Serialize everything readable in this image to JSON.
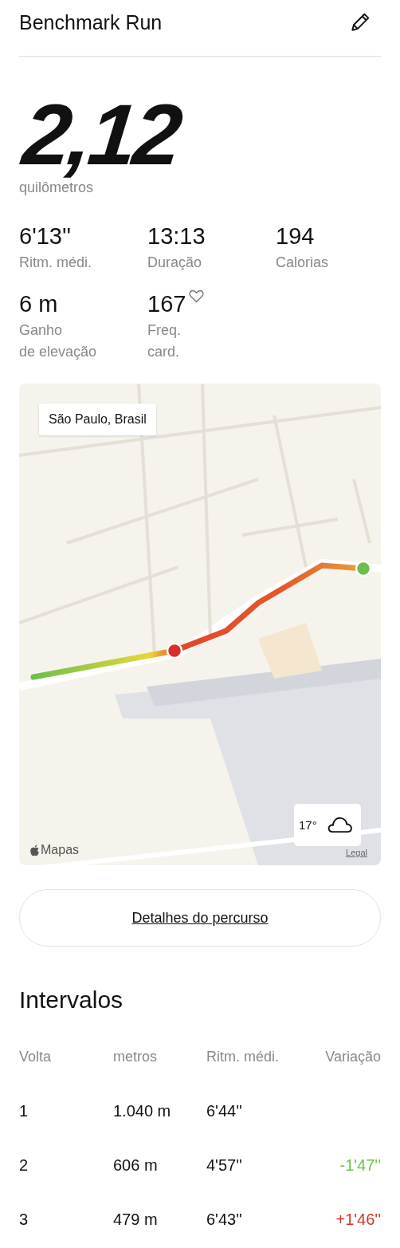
{
  "header": {
    "title": "Benchmark Run"
  },
  "distance": {
    "value": "2,12",
    "unit": "quilômetros"
  },
  "stats": [
    {
      "value": "6'13''",
      "label": "Ritm. médi.",
      "heart": false
    },
    {
      "value": "13:13",
      "label": "Duração",
      "heart": false
    },
    {
      "value": "194",
      "label": "Calorias",
      "heart": false
    },
    {
      "value": "6 m",
      "label": "Ganho\nde elevação",
      "heart": false
    },
    {
      "value": "167",
      "label": "Freq.\ncard.",
      "heart": true
    }
  ],
  "map": {
    "kind": "picture",
    "place_label": "São Paulo, Brasil",
    "temperature": "17°",
    "attribution": "Mapas",
    "legal_link": "Legal"
  },
  "route_button": {
    "label": "Detalhes do percurso"
  },
  "intervals": {
    "title": "Intervalos",
    "columns": [
      "Volta",
      "metros",
      "Ritm. médi.",
      "Variação"
    ],
    "rows": [
      {
        "lap": "1",
        "distance": "1.040 m",
        "pace": "6'44''"
      },
      {
        "lap": "2",
        "distance": "606 m",
        "pace": "4'57''",
        "variation": "-1'47''",
        "color": "#6cc04a"
      },
      {
        "lap": "3",
        "distance": "479 m",
        "pace": "6'43''",
        "variation": "+1'46''",
        "color": "#d0352b"
      }
    ]
  }
}
